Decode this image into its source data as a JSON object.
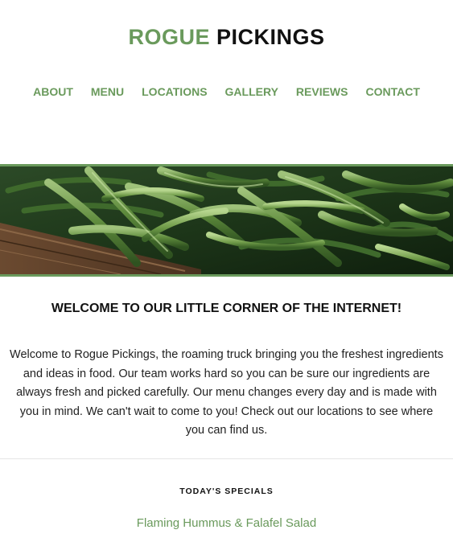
{
  "header": {
    "logo_accent": "ROGUE",
    "logo_main": "PICKINGS"
  },
  "nav": {
    "items": [
      {
        "label": "ABOUT"
      },
      {
        "label": "MENU"
      },
      {
        "label": "LOCATIONS"
      },
      {
        "label": "GALLERY"
      },
      {
        "label": "REVIEWS"
      },
      {
        "label": "CONTACT"
      }
    ]
  },
  "hero": {
    "image": "green-beans-photo"
  },
  "welcome": {
    "title": "WELCOME TO OUR LITTLE CORNER OF THE INTERNET!",
    "body": "Welcome to Rogue Pickings, the roaming truck bringing you the freshest ingredients and ideas in food. Our team works hard so you can be sure our ingredients are always fresh and picked carefully. Our menu changes every day and is made with you in mind. We can't wait to come to you! Check out our locations to see where you can find us."
  },
  "specials": {
    "label": "TODAY'S SPECIALS",
    "items": [
      {
        "name": "Flaming Hummus & Falafel Salad"
      }
    ]
  },
  "colors": {
    "accent": "#6a9a5c",
    "text": "#111111"
  }
}
